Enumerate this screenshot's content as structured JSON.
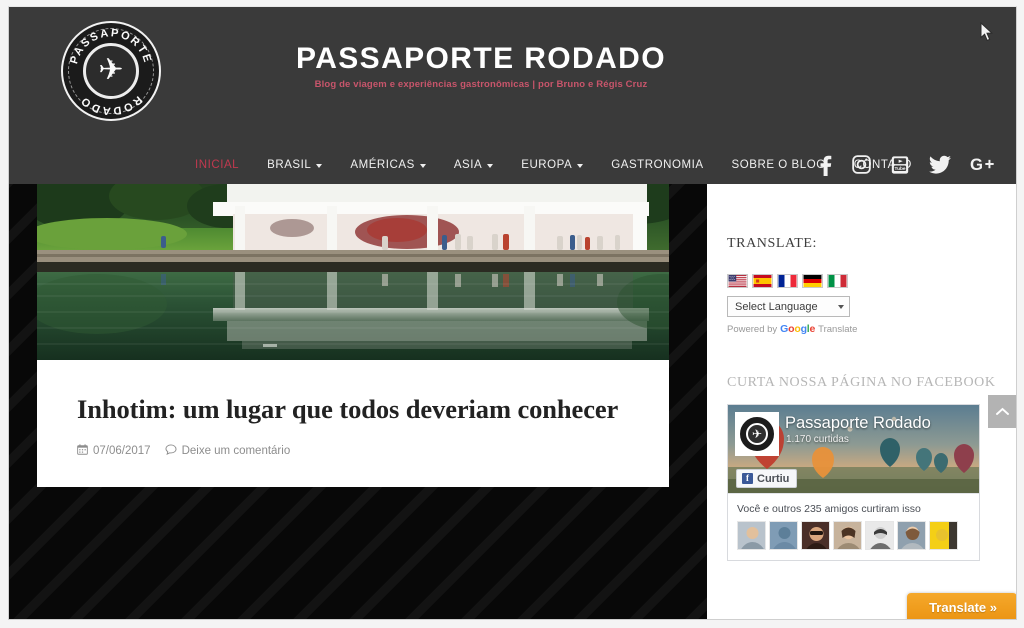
{
  "header": {
    "site_title": "PASSAPORTE RODADO",
    "tagline": "Blog de viagem e experiências gastronômicas | por Bruno e Régis Cruz",
    "logo": {
      "name": "passaporte-rodado-badge",
      "arc_top_text": "PASSAPORTE",
      "arc_bottom_text": "RODADO",
      "center_icon": "airplane-icon"
    },
    "nav_items": [
      {
        "label": "INICIAL",
        "active": true,
        "has_dropdown": false,
        "name": "nav-item-inicial"
      },
      {
        "label": "BRASIL",
        "active": false,
        "has_dropdown": true,
        "name": "nav-item-brasil"
      },
      {
        "label": "AMÉRICAS",
        "active": false,
        "has_dropdown": true,
        "name": "nav-item-americas"
      },
      {
        "label": "ASIA",
        "active": false,
        "has_dropdown": true,
        "name": "nav-item-asia"
      },
      {
        "label": "EUROPA",
        "active": false,
        "has_dropdown": true,
        "name": "nav-item-europa"
      },
      {
        "label": "GASTRONOMIA",
        "active": false,
        "has_dropdown": false,
        "name": "nav-item-gastronomia"
      },
      {
        "label": "SOBRE O BLOG",
        "active": false,
        "has_dropdown": false,
        "name": "nav-item-sobre-o-blog"
      },
      {
        "label": "CONTATO",
        "active": false,
        "has_dropdown": false,
        "name": "nav-item-contato"
      }
    ],
    "social_icons": [
      {
        "name": "facebook-icon",
        "glyph": "f"
      },
      {
        "name": "instagram-icon",
        "glyph": "instagram"
      },
      {
        "name": "youtube-icon",
        "glyph": "youtube"
      },
      {
        "name": "twitter-icon",
        "glyph": "twitter"
      },
      {
        "name": "google-plus-icon",
        "glyph": "G+"
      }
    ]
  },
  "main": {
    "featured_image_alt": "Galeria branca do Inhotim refletida no lago",
    "post": {
      "title": "Inhotim: um lugar que todos deveriam conhecer",
      "date": "07/06/2017",
      "date_icon": "calendar-icon",
      "comments_label": "Deixe um comentário",
      "comments_icon": "comment-icon"
    }
  },
  "sidebar": {
    "translate": {
      "title": "TRANSLATE:",
      "flags": [
        {
          "name": "flag-united-states",
          "label": "English"
        },
        {
          "name": "flag-spain",
          "label": "Español"
        },
        {
          "name": "flag-france",
          "label": "Français"
        },
        {
          "name": "flag-germany",
          "label": "Deutsch"
        },
        {
          "name": "flag-italy",
          "label": "Italiano"
        }
      ],
      "select_value": "Select Language",
      "powered_by_prefix": "Powered by",
      "powered_by_brand": "Google",
      "powered_by_suffix": "Translate"
    },
    "facebook": {
      "title": "CURTA NOSSA PÁGINA NO FACEBOOK",
      "page_name": "Passaporte Rodado",
      "page_likes": "1.170 curtidas",
      "like_button_label": "Curtiu",
      "social_proof": "Você e outros 235 amigos curtiram isso",
      "friend_avatar_count": 7
    }
  },
  "floating": {
    "translate_button_label": "Translate »",
    "scroll_top_icon": "chevron-up-icon"
  },
  "colors": {
    "header_bg": "#3a3a3a",
    "page_bg": "#080808",
    "accent_red": "#c0394f",
    "tagline_pink": "#c8556b",
    "translate_orange": "#eb9413",
    "facebook_blue": "#3b5998"
  }
}
